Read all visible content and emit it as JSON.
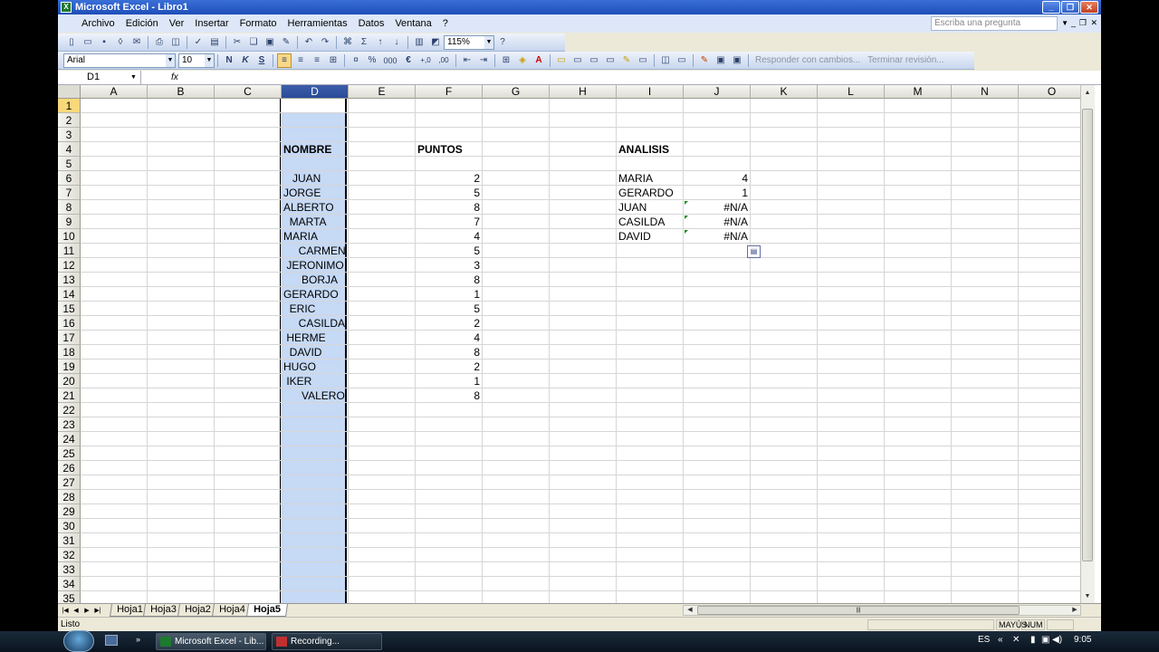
{
  "window": {
    "title": "Microsoft Excel - Libro1"
  },
  "menu": [
    "Archivo",
    "Edición",
    "Ver",
    "Insertar",
    "Formato",
    "Herramientas",
    "Datos",
    "Ventana",
    "?"
  ],
  "ask": {
    "placeholder": "Escriba una pregunta"
  },
  "toolbar": {
    "zoom": "115%",
    "font": "Arial",
    "size": "10",
    "bold": "N",
    "italic": "K",
    "underline": "S",
    "percent": "%",
    "thousands": "000",
    "euro": "€",
    "inc_decimal": "+,0",
    "dec_decimal": ",00",
    "sum": "Σ",
    "reply_changes": "Responder con cambios...",
    "end_review": "Terminar revisión..."
  },
  "formula": {
    "name_box": "D1",
    "fx": "fx",
    "content": ""
  },
  "columns": [
    "A",
    "B",
    "C",
    "D",
    "E",
    "F",
    "G",
    "H",
    "I",
    "J",
    "K",
    "L",
    "M",
    "N",
    "O"
  ],
  "rows": [
    "1",
    "2",
    "3",
    "4",
    "5",
    "6",
    "7",
    "8",
    "9",
    "10",
    "11",
    "12",
    "13",
    "14",
    "15",
    "16",
    "17",
    "18",
    "19",
    "20",
    "21",
    "22",
    "23",
    "24",
    "25",
    "26",
    "27",
    "28",
    "29",
    "30",
    "31",
    "32",
    "33",
    "34",
    "35"
  ],
  "cells": {
    "headers": {
      "nombre": "NOMBRE",
      "puntos": "PUNTOS",
      "analisis": "ANALISIS"
    },
    "nombres": [
      "   JUAN",
      "JORGE",
      "ALBERTO",
      "  MARTA",
      "MARIA",
      "     CARMEN",
      " JERONIMO",
      "      BORJA",
      "GERARDO",
      "  ERIC",
      "     CASILDA",
      " HERME",
      "  DAVID",
      "HUGO",
      " IKER",
      "      VALERO"
    ],
    "puntos": [
      "2",
      "5",
      "8",
      "7",
      "4",
      "5",
      "3",
      "8",
      "1",
      "5",
      "2",
      "4",
      "8",
      "2",
      "1",
      "8"
    ],
    "analisis_nombres": [
      "MARIA",
      "GERARDO",
      "JUAN",
      "CASILDA",
      "DAVID"
    ],
    "analisis_valores": [
      "4",
      "1",
      "#N/A",
      "#N/A",
      "#N/A"
    ]
  },
  "sheets": [
    "Hoja1",
    "Hoja3",
    "Hoja2",
    "Hoja4",
    "Hoja5"
  ],
  "active_sheet": "Hoja5",
  "status": {
    "ready": "Listo",
    "caps": "MAYÚS",
    "num": "NUM"
  },
  "taskbar": {
    "items": [
      "Microsoft Excel - Lib...",
      "Recording..."
    ],
    "lang": "ES",
    "clock": "9:05"
  }
}
